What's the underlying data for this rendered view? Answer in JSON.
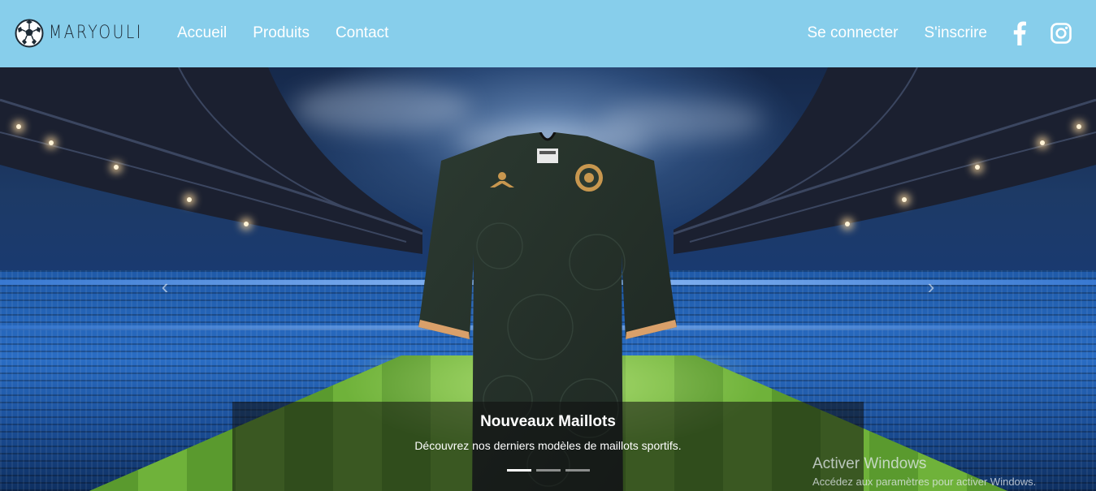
{
  "navbar": {
    "brand_text": "MARYOULI",
    "links": [
      {
        "label": "Accueil"
      },
      {
        "label": "Produits"
      },
      {
        "label": "Contact"
      }
    ],
    "auth": {
      "login_label": "Se connecter",
      "register_label": "S'inscrire"
    },
    "social_icons": [
      "facebook-icon",
      "instagram-icon"
    ],
    "background_color": "#87ceeb"
  },
  "carousel": {
    "slide_title": "Nouveaux Maillots",
    "slide_text": "Découvrez nos derniers modèles de maillots sportifs.",
    "indicator_count": 3,
    "active_index": 0
  },
  "os_watermark": {
    "title": "Activer Windows",
    "subtitle": "Accédez aux paramètres pour activer Windows."
  }
}
